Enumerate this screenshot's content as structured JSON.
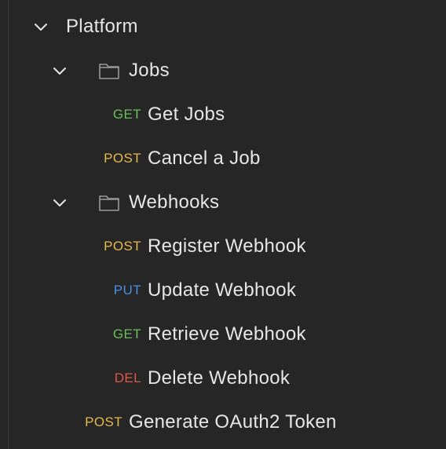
{
  "tree": {
    "collection": {
      "label": "Platform",
      "icon": "chevron-down-icon"
    },
    "folders": [
      {
        "label": "Jobs",
        "icon": "folder-icon",
        "requests": [
          {
            "method": "GET",
            "name": "Get Jobs"
          },
          {
            "method": "POST",
            "name": "Cancel a Job"
          }
        ]
      },
      {
        "label": "Webhooks",
        "icon": "folder-icon",
        "requests": [
          {
            "method": "POST",
            "name": "Register Webhook"
          },
          {
            "method": "PUT",
            "name": "Update Webhook"
          },
          {
            "method": "GET",
            "name": "Retrieve Webhook"
          },
          {
            "method": "DEL",
            "name": "Delete Webhook"
          }
        ]
      }
    ],
    "root_requests": [
      {
        "method": "POST",
        "name": "Generate OAuth2 Token"
      }
    ]
  },
  "colors": {
    "background": "#262626",
    "text": "#e6e6e6",
    "get": "#6bbf59",
    "post": "#e8b84a",
    "put": "#4a8fe0",
    "del": "#e0554a"
  }
}
